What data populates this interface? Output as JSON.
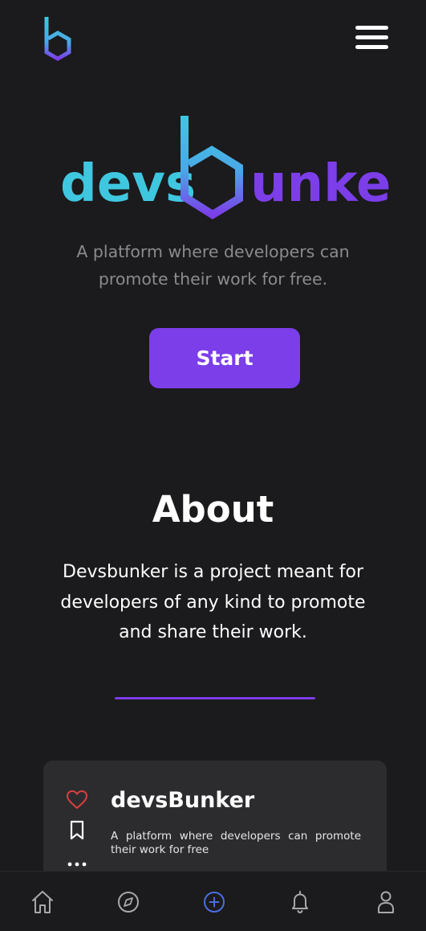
{
  "header": {
    "logo_icon": "devsbunker-b-logo-icon",
    "menu_icon": "hamburger-menu-icon"
  },
  "hero": {
    "brand_left": "devs",
    "brand_right": "unker",
    "brand_colors": {
      "teal": "#3fc7e0",
      "purple": "#7b3ee8"
    },
    "tagline": "A platform where developers can promote their work for free.",
    "start_label": "Start"
  },
  "about": {
    "title": "About",
    "text": "Devsbunker is a project meant for developers of any kind to promote and share their work."
  },
  "card": {
    "title": "devsBunker",
    "description": "A platform where developers can promote their work for free",
    "actions": [
      "heart-icon",
      "bookmark-icon",
      "more-dots-icon"
    ]
  },
  "bottom_nav": {
    "items": [
      "home-icon",
      "compass-icon",
      "add-circle-icon",
      "bell-icon",
      "profile-icon"
    ],
    "active": "add-circle-icon",
    "active_color": "#4a6ee0"
  }
}
